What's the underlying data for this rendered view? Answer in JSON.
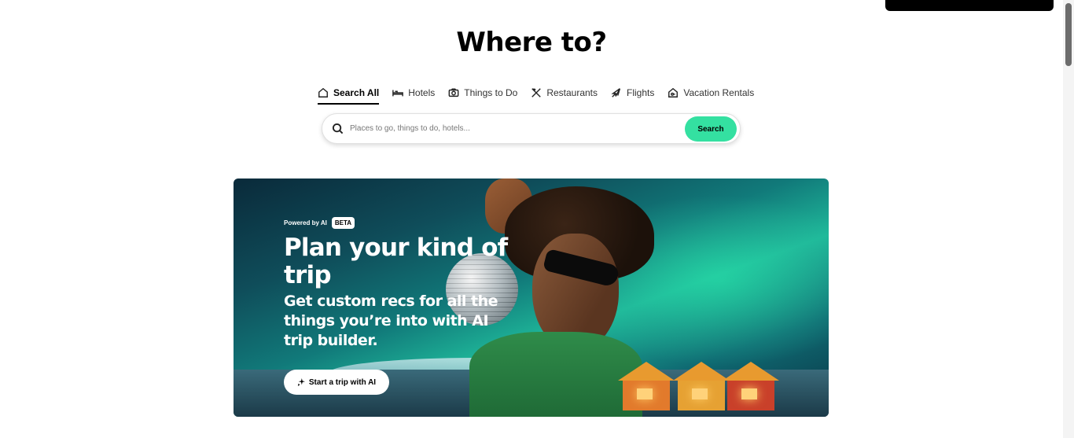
{
  "header": {
    "title": "Where to?"
  },
  "tabs": [
    {
      "label": "Search All",
      "icon": "home-icon",
      "active": true
    },
    {
      "label": "Hotels",
      "icon": "bed-icon",
      "active": false
    },
    {
      "label": "Things to Do",
      "icon": "camera-icon",
      "active": false
    },
    {
      "label": "Restaurants",
      "icon": "fork-knife-icon",
      "active": false
    },
    {
      "label": "Flights",
      "icon": "plane-icon",
      "active": false
    },
    {
      "label": "Vacation Rentals",
      "icon": "house-icon",
      "active": false
    }
  ],
  "search": {
    "placeholder": "Places to go, things to do, hotels...",
    "button_label": "Search",
    "button_color": "#34e0a1"
  },
  "banner": {
    "powered_label": "Powered by AI",
    "beta_label": "BETA",
    "title": "Plan your kind of trip",
    "subtitle": "Get custom recs for all the things you’re into with AI trip builder.",
    "cta_label": "Start a trip with AI"
  }
}
